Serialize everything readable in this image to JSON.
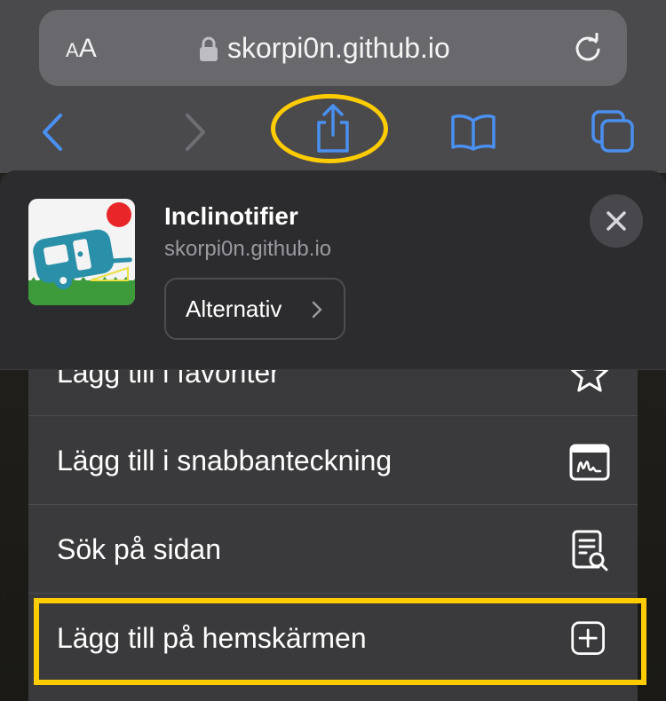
{
  "address_bar": {
    "text_size_label_large": "A",
    "text_size_label_small": "A",
    "url": "skorpi0n.github.io"
  },
  "toolbar": {
    "icons": [
      "back-icon",
      "forward-icon",
      "share-icon",
      "bookmarks-icon",
      "tabs-icon"
    ]
  },
  "share_sheet": {
    "app_title": "Inclinotifier",
    "app_subtitle": "skorpi0n.github.io",
    "options_label": "Alternativ",
    "actions": [
      {
        "label": "Lägg till i favoriter",
        "icon": "star-icon"
      },
      {
        "label": "Lägg till i snabbanteckning",
        "icon": "quick-note-icon"
      },
      {
        "label": "Sök på sidan",
        "icon": "find-on-page-icon"
      },
      {
        "label": "Lägg till på hemskärmen",
        "icon": "add-to-home-icon"
      }
    ]
  },
  "colors": {
    "accent": "#4a90f0",
    "highlight": "#ffcc00",
    "chrome_background": "#4a4a4d",
    "sheet_background": "#2c2c2e",
    "list_background": "#3a3a3c"
  }
}
